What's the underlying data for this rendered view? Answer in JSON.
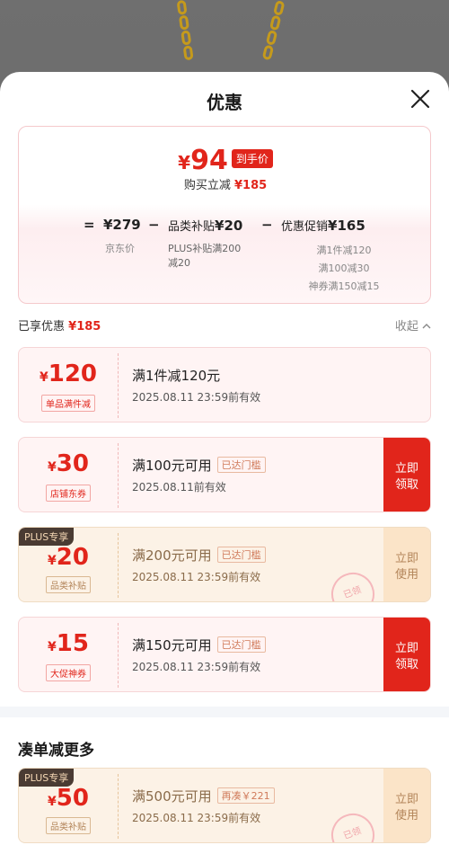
{
  "sheet": {
    "title": "优惠"
  },
  "summary": {
    "final_symbol": "¥",
    "final_price": "94",
    "final_tag": "到手价",
    "buy_line_label": "购买立减",
    "buy_line_value": "¥185",
    "jd_price": "¥279",
    "jd_price_label": "京东价",
    "category_label": "品类补贴",
    "category_value": "¥20",
    "category_sub": [
      "PLUS补贴满200",
      "减20"
    ],
    "promo_label": "优惠促销",
    "promo_value": "¥165",
    "promo_sub": [
      "满1件减120",
      "满100减30",
      "神券满150减15"
    ],
    "op_eq": "=",
    "op_minus1": "−",
    "op_minus2": "−"
  },
  "enjoyed": {
    "label": "已享优惠",
    "value": "¥185",
    "collapse_label": "收起"
  },
  "coupons": [
    {
      "amount": "120",
      "kind": "单品满件减",
      "condition": "满1件减120元",
      "badge": "",
      "valid": "2025.08.11  23:59前有效",
      "action": "",
      "plus": false
    },
    {
      "amount": "30",
      "kind": "店铺东券",
      "condition": "满100元可用",
      "badge": "已达门槛",
      "valid": "2025.08.11前有效",
      "action": "立即领取",
      "plus": false
    },
    {
      "amount": "20",
      "kind": "品类补贴",
      "condition": "满200元可用",
      "badge": "已达门槛",
      "valid": "2025.08.11  23:59前有效",
      "action": "立即使用",
      "plus": true,
      "plus_tag": "PLUS专享",
      "stamp": "已领"
    },
    {
      "amount": "15",
      "kind": "大促神券",
      "condition": "满150元可用",
      "badge": "已达门槛",
      "valid": "2025.08.11  23:59前有效",
      "action": "立即领取",
      "plus": false
    }
  ],
  "more_section": {
    "title": "凑单减更多",
    "coupon": {
      "amount": "50",
      "kind": "品类补贴",
      "condition": "满500元可用",
      "badge": "再凑￥221",
      "valid": "2025.08.11  23:59前有效",
      "action": "立即使用",
      "plus_tag": "PLUS专享",
      "stamp": "已领"
    }
  },
  "currency": "¥",
  "colors": {
    "accent": "#e1251b",
    "plus_bg": "#fcf2e6",
    "plus_dark": "#4a3b33"
  },
  "icons": {
    "close": "close-icon",
    "collapse": "chevron-up-icon"
  }
}
